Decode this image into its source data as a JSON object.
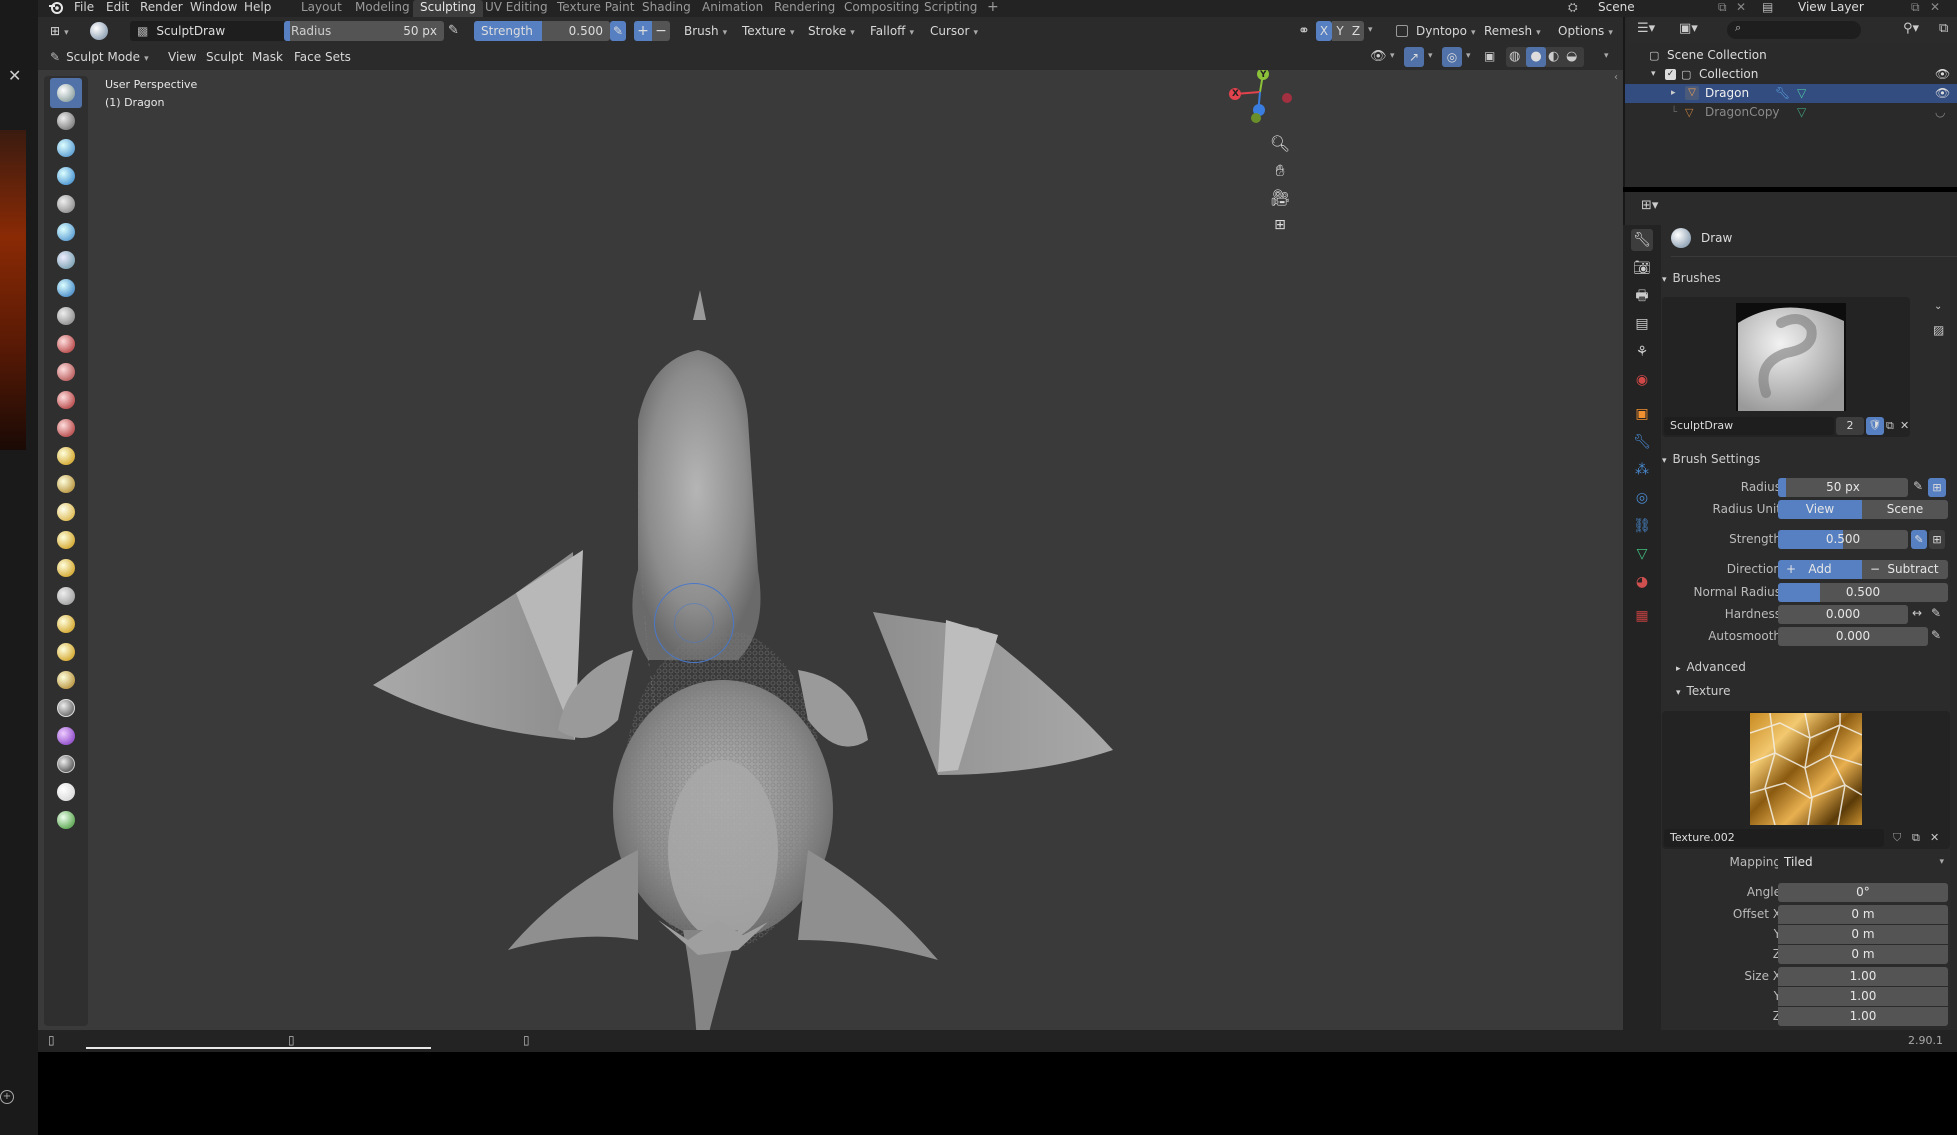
{
  "app": {
    "logo": "blender-logo-icon"
  },
  "menubar": {
    "items": [
      "File",
      "Edit",
      "Render",
      "Window",
      "Help"
    ]
  },
  "workspaces": {
    "tabs": [
      "Layout",
      "Modeling",
      "Sculpting",
      "UV Editing",
      "Texture Paint",
      "Shading",
      "Animation",
      "Rendering",
      "Compositing",
      "Scripting"
    ],
    "active": "Sculpting",
    "add": "+"
  },
  "top_right": {
    "scene_label": "Scene",
    "view_layer_label": "View Layer"
  },
  "toolheader": {
    "brush_name": "SculptDraw",
    "radius_label": "Radius",
    "radius_value": "50 px",
    "strength_label": "Strength",
    "strength_value": "0.500",
    "menus": [
      "Brush",
      "Texture",
      "Stroke",
      "Falloff",
      "Cursor"
    ],
    "axes": [
      "X",
      "Y",
      "Z"
    ],
    "dyntopo": "Dyntopo",
    "remesh": "Remesh",
    "options": "Options"
  },
  "viewheader": {
    "mode": "Sculpt Mode",
    "menus": [
      "View",
      "Sculpt",
      "Mask",
      "Face Sets"
    ]
  },
  "viewport": {
    "perspective": "User Perspective",
    "object": "(1) Dragon",
    "gizmo": {
      "x": "X",
      "y": "Y",
      "z": "Z"
    }
  },
  "outliner": {
    "scene_collection": "Scene Collection",
    "collection": "Collection",
    "objects": [
      "Dragon",
      "DragonCopy"
    ]
  },
  "properties": {
    "active_tool": "Draw",
    "brushes_header": "Brushes",
    "brush_name": "SculptDraw",
    "brush_users": "2",
    "brush_settings_header": "Brush Settings",
    "rows": [
      {
        "label": "Radius",
        "value": "50 px"
      },
      {
        "label": "Radius Unit",
        "options": [
          "View",
          "Scene"
        ]
      },
      {
        "label": "Strength",
        "value": "0.500"
      },
      {
        "label": "Direction",
        "options": [
          "Add",
          "Subtract"
        ]
      },
      {
        "label": "Normal Radius",
        "value": "0.500"
      },
      {
        "label": "Hardness",
        "value": "0.000"
      },
      {
        "label": "Autosmooth",
        "value": "0.000"
      }
    ],
    "advanced": "Advanced",
    "texture_header": "Texture",
    "texture_name": "Texture.002",
    "texture_rows": [
      {
        "label": "Mapping",
        "value": "Tiled"
      },
      {
        "label": "Angle",
        "value": "0°"
      },
      {
        "label": "Offset X",
        "value": "0 m"
      },
      {
        "label": "Y",
        "value": "0 m"
      },
      {
        "label": "Z",
        "value": "0 m"
      },
      {
        "label": "Size X",
        "value": "1.00"
      },
      {
        "label": "Y",
        "value": "1.00"
      },
      {
        "label": "Z",
        "value": "1.00"
      }
    ]
  },
  "status": {
    "version": "2.90.1"
  },
  "colors": {
    "accent": "#5680c2",
    "selected_row": "#334d80",
    "viewport_bg": "#3a3a3a",
    "panel_bg": "#2b2b2b"
  }
}
